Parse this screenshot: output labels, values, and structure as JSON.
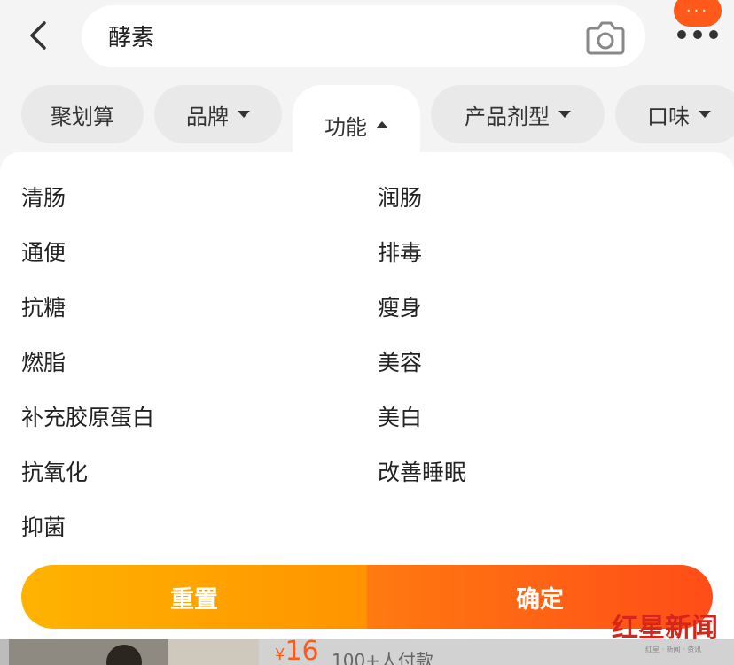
{
  "search": {
    "query": "酵素"
  },
  "header": {
    "more_badge": "···"
  },
  "filters": [
    {
      "label": "聚划算"
    },
    {
      "label": "品牌"
    },
    {
      "label": "功能"
    },
    {
      "label": "产品剂型"
    },
    {
      "label": "口味"
    }
  ],
  "function_options": [
    "清肠",
    "润肠",
    "通便",
    "排毒",
    "抗糖",
    "瘦身",
    "燃脂",
    "美容",
    "补充胶原蛋白",
    "美白",
    "抗氧化",
    "改善睡眠",
    "抑菌"
  ],
  "actions": {
    "reset": "重置",
    "confirm": "确定"
  },
  "product_peek": {
    "price_symbol": "¥",
    "price": "16",
    "sold": "100+人付款"
  },
  "watermark": {
    "title": "红星新闻",
    "subtitle": "红星 · 新闻 · 资讯"
  },
  "colors": {
    "accent": "#ff5a1a",
    "reset_start": "#ffb300",
    "confirm_end": "#ff4d18"
  },
  "icons": [
    "back-arrow-icon",
    "camera-icon",
    "more-icon",
    "caret-down-icon",
    "caret-up-icon"
  ]
}
